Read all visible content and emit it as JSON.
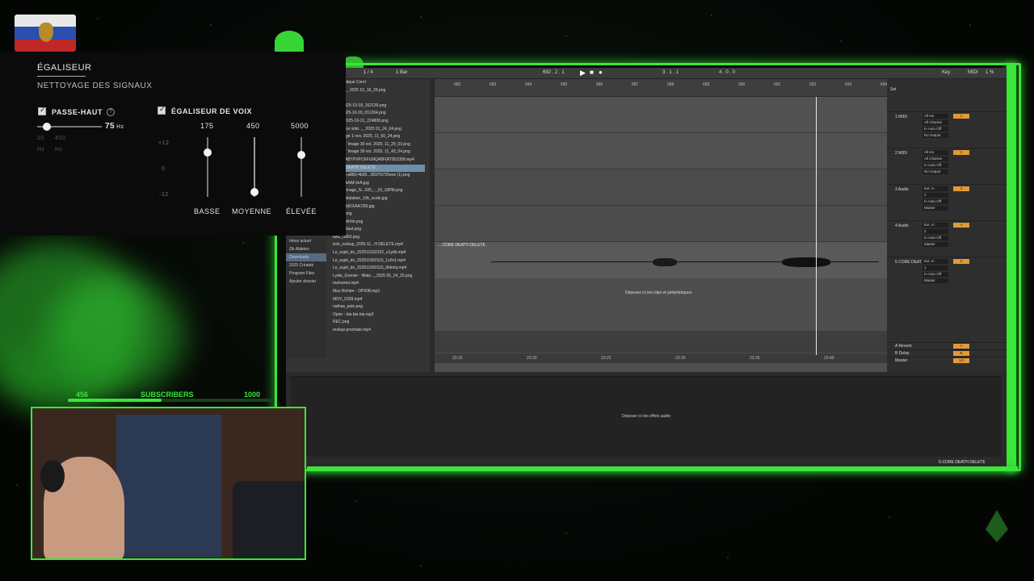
{
  "eq": {
    "title": "ÉGALISEUR",
    "subtitle": "NETTOYAGE DES SIGNAUX",
    "highpass_label": "PASSE-HAUT",
    "highpass_help": "?",
    "highpass_value": "75",
    "highpass_unit": "Hz",
    "hp_min": "20",
    "hp_max": "400",
    "hp_unit_a": "Hz",
    "hp_unit_b": "Hz",
    "voice_label": "ÉGALISEUR DE VOIX",
    "db_top": "+12",
    "db_mid": "0",
    "db_bot": "-12",
    "bands": [
      {
        "freq": "175",
        "name": "BASSE"
      },
      {
        "freq": "450",
        "name": "MOYENNE"
      },
      {
        "freq": "5000",
        "name": "ÉLEVÉE"
      }
    ]
  },
  "subs": {
    "current": "456",
    "label": "SUBSCRIBERS",
    "goal": "1000"
  },
  "daw": {
    "transport": {
      "bars": "1 / 4",
      "quant": "1 Bar",
      "position": "692 . 2 . 1",
      "loop_start": "3 . 1 . 1",
      "loop_len": "4 . 0 . 0",
      "key": "Key",
      "midi": "MIDI",
      "cpu": "1 %"
    },
    "places": [
      "Inbox actuel",
      "Zik Ableton",
      "Downloads",
      "2025 Créatek",
      "Program Files",
      "Ajouter dossier"
    ],
    "files": [
      "automatique Corel",
      "da en..._ 2025 10_16_28.png",
      "2.jpg",
      "ran_ 2025-10-18_162139.png",
      "cran 2025-10-29_011204.png",
      "écran 2025-10-31_224808.png",
      "es de vos vidé..._ 2025 01_24_04.png",
      "PT Image 1 nov. 2025, 11_50_24.png",
      "hatGPT Image 30 oct. 2025, 11_29_03.png",
      "hatGPT Image 30 oct. 2025, 11_43_04.png",
      "EA_33ABTPVPCKFUNQ4BF(RT80J358.mp4",
      "CORE DEATH DELETE",
      "b6d426-a880-4b00...381f7b725ees (1).png",
      "hat-DRkAAFJeA.jpg",
      "eated_Image_N...025_-_10_10PM.png",
      "ood_ondulation_10k_scale.jpg",
      "afyCOBdDXAA73l0.jpg",
      "image.png",
      "imagehhhhh.png",
      "imageuluiul.png",
      "IMG_0850.png",
      "kick_reskup_2025-11...H DELETE.mp4",
      "Le_sujet_de_202511032322_u1ydk.mp4",
      "Le_sujet_de_202511060115_1z0v1.mp4",
      "Le_sujet_de_202511060115_tlhkmq.mp4",
      "Lydie_Grenier - Wats..._2025 05_24_10.png",
      "mahomet.mp4",
      "Max Richter - OPIOB.mp3",
      "MOV_0339.mp4",
      "nathas_pelo.png",
      "Opior - bia bia bia.mp3",
      "REC.png",
      "reskup prochate.mp4"
    ],
    "ruler_top": [
      "682",
      "683",
      "684",
      "685",
      "686",
      "687",
      "688",
      "689",
      "690",
      "691",
      "692",
      "693",
      "694"
    ],
    "ruler_bottom": [
      "23:15",
      "23:20",
      "23:25",
      "23:30",
      "23:35",
      "23:40"
    ],
    "clip_name": "... CORE DEATH DELETE",
    "drop_clips": "Déposez ici les clips et périphériques",
    "drop_effects": "Déposer ici les effets audio",
    "set_label": "Set",
    "status_clip": "5-CORE DEATH DELETE",
    "tracks": [
      {
        "name": "1 MIDI",
        "input": "All Ins",
        "channel": "All Channe",
        "monitor": "In Auto Off",
        "out": "No Output",
        "num": "1"
      },
      {
        "name": "2 MIDI",
        "input": "All Ins",
        "channel": "All Channe",
        "monitor": "In Auto Off",
        "out": "No Output",
        "num": "2"
      },
      {
        "name": "3 Audio",
        "input": "Ext. In",
        "channel": "1",
        "monitor": "In Auto Off",
        "out": "Master",
        "num": "3"
      },
      {
        "name": "4 Audio",
        "input": "Ext. In",
        "channel": "2",
        "monitor": "In Auto Off",
        "out": "Master",
        "num": "4"
      },
      {
        "name": "5 CORE DEAT",
        "input": "Ext. In",
        "channel": "1",
        "monitor": "In Auto Off",
        "out": "Master",
        "num": "5"
      }
    ],
    "returns": [
      {
        "name": "A Reverb",
        "num": "A"
      },
      {
        "name": "B Delay",
        "num": "B"
      },
      {
        "name": "Master",
        "num": "1/2"
      }
    ]
  }
}
